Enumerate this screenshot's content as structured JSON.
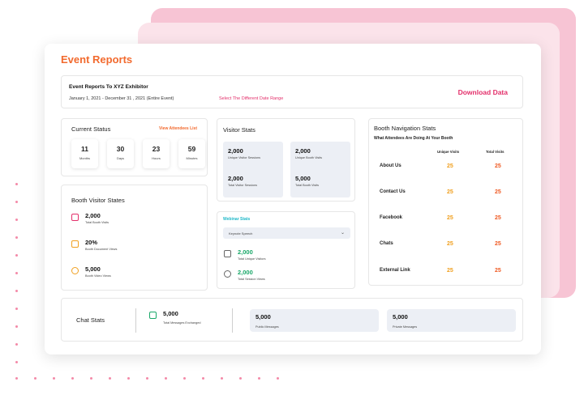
{
  "page_title": "Event Reports",
  "header": {
    "title": "Event Reports To XYZ Exhibitor",
    "date_range": "January 1, 2021 - December 31 , 2021 (Entire Event)",
    "range_link": "Select The Different Date Range",
    "download": "Download Data"
  },
  "current_status": {
    "title": "Current Status",
    "link": "View Attendees List",
    "tiles": [
      {
        "value": "11",
        "label": "Months"
      },
      {
        "value": "30",
        "label": "Days"
      },
      {
        "value": "23",
        "label": "Hours"
      },
      {
        "value": "59",
        "label": "Minutes"
      }
    ]
  },
  "booth_visitor": {
    "title": "Booth Visitor States",
    "items": [
      {
        "value": "2,000",
        "label": "Total Booth Visits",
        "icon": "calendar-icon"
      },
      {
        "value": "20%",
        "label": "Booth Document Views",
        "icon": "document-icon"
      },
      {
        "value": "5,000",
        "label": "Booth Video Views",
        "icon": "play-icon"
      }
    ]
  },
  "visitor_stats": {
    "title": "Visitor Stats",
    "items": [
      {
        "value": "2,000",
        "label": "Unique Visitor Sessions"
      },
      {
        "value": "2,000",
        "label": "Total Visitor Sessions"
      },
      {
        "value": "2,000",
        "label": "Unique Booth Visits"
      },
      {
        "value": "5,000",
        "label": "Total Booth Visits"
      }
    ]
  },
  "webinar_stats": {
    "title": "Webinar Stats",
    "selected": "Keynote Speech",
    "items": [
      {
        "value": "2,000",
        "label": "Total Unique Visitors",
        "icon": "laptop-icon"
      },
      {
        "value": "2,000",
        "label": "Total Session Views",
        "icon": "eye-icon"
      }
    ]
  },
  "booth_navigation": {
    "title": "Booth Navigation Stats",
    "subtitle": "What Attendees Are Doing At Your Booth",
    "col_unique": "Unique Visits",
    "col_total": "Total Visits",
    "rows": [
      {
        "label": "About Us",
        "unique": "25",
        "total": "25"
      },
      {
        "label": "Contact Us",
        "unique": "25",
        "total": "25"
      },
      {
        "label": "Facebook",
        "unique": "25",
        "total": "25"
      },
      {
        "label": "Chats",
        "unique": "25",
        "total": "25"
      },
      {
        "label": "External Link",
        "unique": "25",
        "total": "25"
      }
    ]
  },
  "chat_stats": {
    "title": "Chat Stats",
    "total": {
      "value": "5,000",
      "label": "Total Messages Exchanged",
      "icon": "chat-icon"
    },
    "public": {
      "value": "5,000",
      "label": "Public Messages"
    },
    "private": {
      "value": "5,000",
      "label": "Private Messages"
    }
  },
  "colors": {
    "accent": "#f26a2e",
    "pink": "#e3306b",
    "teal": "#1fb8c8",
    "green": "#1aa869",
    "yellow": "#f0a020"
  }
}
